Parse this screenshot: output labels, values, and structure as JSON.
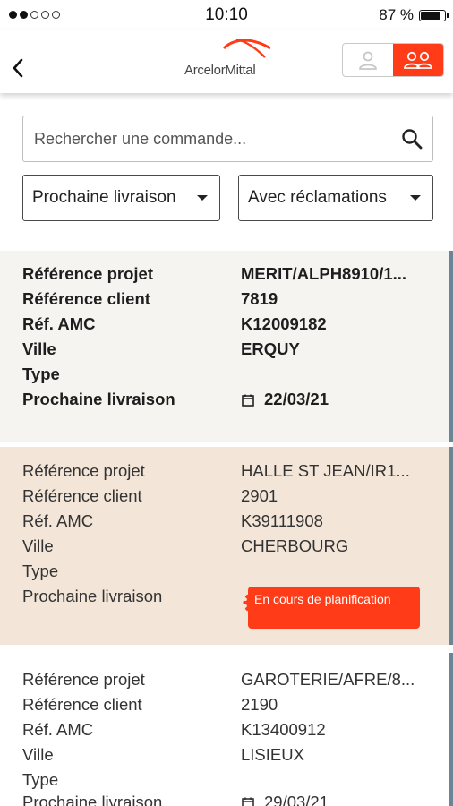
{
  "status_bar": {
    "time": "10:10",
    "battery": "87 %"
  },
  "header": {
    "brand": "ArcelorMittal"
  },
  "search": {
    "placeholder": "Rechercher une commande..."
  },
  "filters": {
    "delivery": "Prochaine livraison",
    "claims": "Avec réclamations"
  },
  "labels": {
    "project_ref": "Référence projet",
    "client_ref": "Référence client",
    "amc_ref": "Réf. AMC",
    "city": "Ville",
    "type": "Type",
    "next_delivery": "Prochaine livraison"
  },
  "orders": [
    {
      "project_ref": "MERIT/ALPH8910/1...",
      "client_ref": "7819",
      "amc_ref": "K12009182",
      "city": "ERQUY",
      "type": "",
      "next_delivery": "22/03/21"
    },
    {
      "project_ref": "HALLE ST JEAN/IR1...",
      "client_ref": "2901",
      "amc_ref": "K39111908",
      "city": "CHERBOURG",
      "type": "",
      "status": "En cours de planification"
    },
    {
      "project_ref": "GAROTERIE/AFRE/8...",
      "client_ref": "2190",
      "amc_ref": "K13400912",
      "city": "LISIEUX",
      "type": "",
      "next_delivery": "29/03/21"
    }
  ],
  "colors": {
    "accent": "#ff3b18",
    "card1_bg": "#f6f4f1",
    "card2_bg": "#f3e6d9",
    "stripe": "#6b8596"
  }
}
